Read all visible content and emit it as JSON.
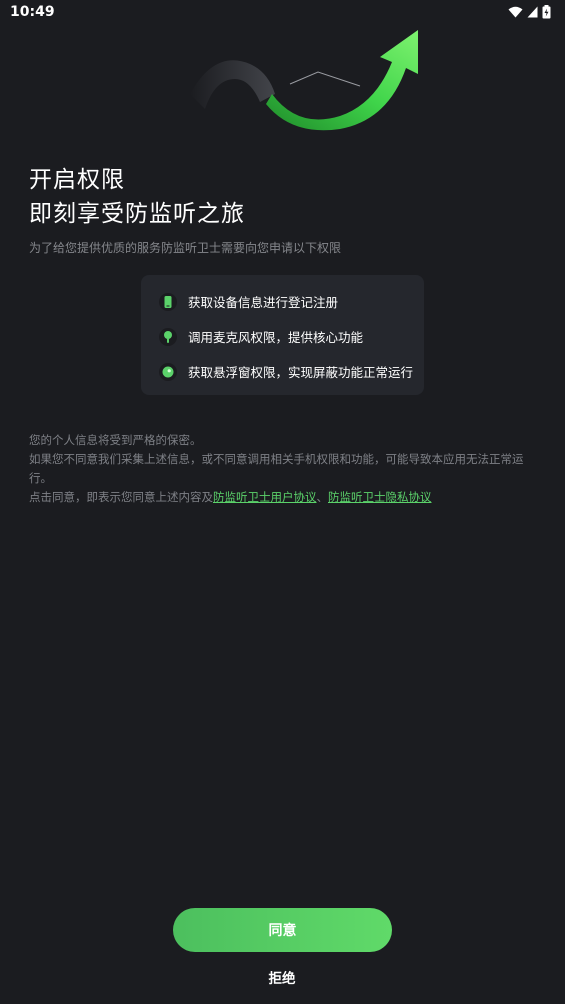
{
  "status_bar": {
    "time": "10:49",
    "icons": [
      "wifi-icon",
      "signal-icon",
      "battery-icon"
    ]
  },
  "header": {
    "title_line1": "开启权限",
    "title_line2": "即刻享受防监听之旅",
    "subtitle": "为了给您提供优质的服务防监听卫士需要向您申请以下权限"
  },
  "permissions": [
    {
      "icon": "phone-icon",
      "label": "获取设备信息进行登记注册"
    },
    {
      "icon": "microphone-icon",
      "label": "调用麦克风权限，提供核心功能"
    },
    {
      "icon": "floating-window-icon",
      "label": "获取悬浮窗权限，实现屏蔽功能正常运行"
    }
  ],
  "notice": {
    "line1": "您的个人信息将受到严格的保密。",
    "line2": "如果您不同意我们采集上述信息，或不同意调用相关手机权限和功能，可能导致本应用无法正常运行。",
    "line3_prefix": "点击同意，即表示您同意上述内容及",
    "user_agreement": "防监听卫士用户协议",
    "separator": "、",
    "privacy_policy": "防监听卫士隐私协议"
  },
  "actions": {
    "agree": "同意",
    "reject": "拒绝"
  },
  "colors": {
    "background": "#1b1c20",
    "card": "#25272d",
    "accent": "#5bd26a",
    "muted_text": "#7e8086"
  }
}
